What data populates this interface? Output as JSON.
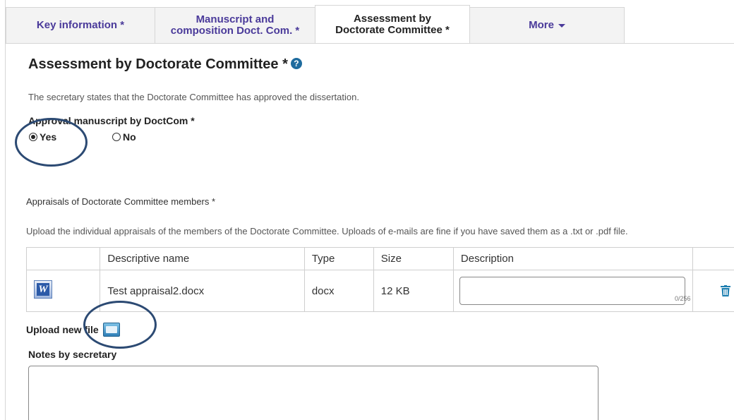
{
  "tabs": [
    {
      "label": "Key information *"
    },
    {
      "label_line1": "Manuscript and",
      "label_line2": "composition Doct. Com. *"
    },
    {
      "label_line1": "Assessment by",
      "label_line2": "Doctorate Committee *"
    },
    {
      "label": "More"
    }
  ],
  "section": {
    "title": "Assessment by Doctorate Committee *",
    "help_icon": "?",
    "intro": "The secretary states that the Doctorate Committee has approved the dissertation."
  },
  "approval": {
    "label": "Approval manuscript by DoctCom *",
    "options": [
      {
        "label": "Yes",
        "selected": true
      },
      {
        "label": "No",
        "selected": false
      }
    ]
  },
  "appraisals": {
    "label": "Appraisals of Doctorate Committee members *",
    "hint": "Upload the individual appraisals of the members of the Doctorate Committee. Uploads of e-mails are fine if you have saved them as a .txt or .pdf file.",
    "columns": [
      "",
      "Descriptive name",
      "Type",
      "Size",
      "Description"
    ],
    "rows": [
      {
        "icon": "W",
        "name": "Test appraisal2.docx",
        "type": "docx",
        "size": "12 KB",
        "description": "",
        "counter": "0/256"
      }
    ]
  },
  "upload": {
    "label": "Upload new file"
  },
  "notes": {
    "label": "Notes by secretary",
    "value": ""
  },
  "colors": {
    "tab_text": "#4a3a9a",
    "help_icon": "#1e6b9e",
    "annotation_circle": "#2c4a73",
    "trash_icon": "#1e7fb0"
  }
}
